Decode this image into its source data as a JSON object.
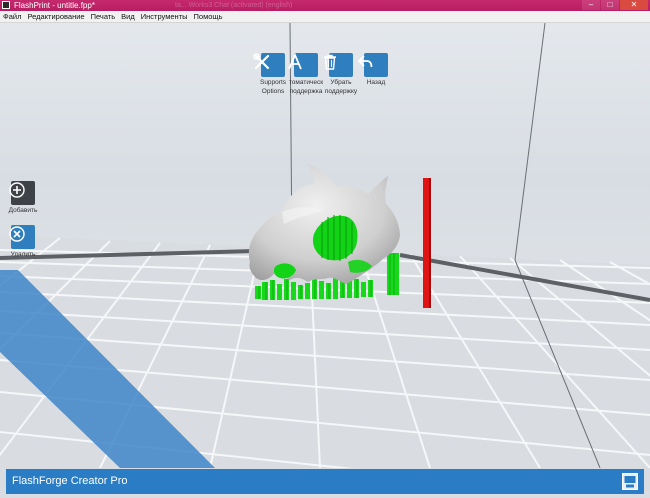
{
  "window": {
    "title": "FlashPrint - untitle.fpp*",
    "background_title": "ta... Works3 Chat (activated) (english)"
  },
  "menu": {
    "items": [
      "Файл",
      "Редактирование",
      "Печать",
      "Вид",
      "Инструменты",
      "Помощь"
    ]
  },
  "toolbar": {
    "buttons": [
      {
        "label_line1": "Supports",
        "label_line2": "Options",
        "icon": "wrench-screwdriver-icon"
      },
      {
        "label_line1": "томатическ",
        "label_line2": "поддержка",
        "icon": "auto-support-a-icon"
      },
      {
        "label_line1": "Убрать",
        "label_line2": "поддержку",
        "icon": "trash-icon"
      },
      {
        "label_line1": "Назад",
        "label_line2": "",
        "icon": "undo-arrow-icon"
      }
    ]
  },
  "side": {
    "add_label": "Добавить",
    "remove_label": "Удалить"
  },
  "status": {
    "printer": "FlashForge Creator Pro"
  },
  "colors": {
    "accent": "#2a7dc4",
    "support": "#1ed31e",
    "model": "#d4d4d4",
    "axis_marker": "#e31212",
    "title_bar": "#c02668"
  }
}
